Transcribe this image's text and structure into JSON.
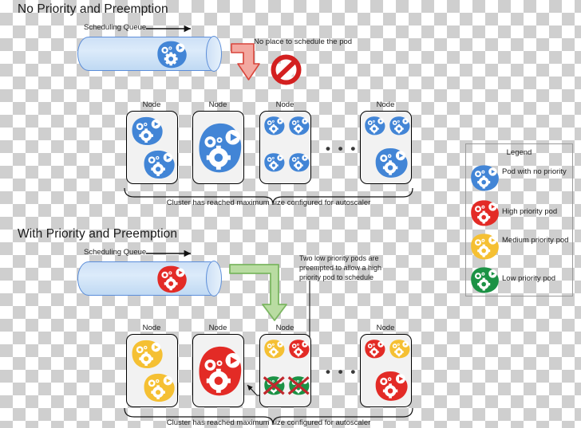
{
  "sections": [
    {
      "id": "no-priority",
      "title": "No Priority and Preemption",
      "queue_label": "Scheduling Queue",
      "annotation": "No place to schedule the pod",
      "cluster_caption": "Cluster has reached maximum size configured for autoscaler",
      "queue_pod_color": "blue",
      "node_label": "Node",
      "ellipsis": "• • •",
      "nodes": [
        {
          "label": "Node",
          "pods": [
            {
              "color": "blue",
              "size": "md"
            },
            {
              "color": "blue",
              "size": "md"
            }
          ]
        },
        {
          "label": "Node",
          "pods": [
            {
              "color": "blue",
              "size": "lg"
            }
          ]
        },
        {
          "label": "Node",
          "pods": [
            {
              "color": "blue",
              "size": "sm"
            },
            {
              "color": "blue",
              "size": "sm"
            },
            {
              "color": "blue",
              "size": "sm"
            },
            {
              "color": "blue",
              "size": "sm"
            }
          ]
        },
        {
          "label": "Node",
          "pods": [
            {
              "color": "blue",
              "size": "sm"
            },
            {
              "color": "blue",
              "size": "sm"
            },
            {
              "color": "blue",
              "size": "md"
            }
          ]
        }
      ]
    },
    {
      "id": "with-priority",
      "title": "With Priority and Preemption",
      "queue_label": "Scheduling Queue",
      "annotation": "Two low priority pods are preempted to allow a high priority pod to schedule",
      "cluster_caption": "Cluster has reached maximum size configured for autoscaler",
      "queue_pod_color": "red",
      "node_label": "Node",
      "ellipsis": "• • •",
      "nodes": [
        {
          "label": "Node",
          "pods": [
            {
              "color": "yellow",
              "size": "md"
            },
            {
              "color": "yellow",
              "size": "md"
            }
          ]
        },
        {
          "label": "Node",
          "pods": [
            {
              "color": "red",
              "size": "lg"
            }
          ]
        },
        {
          "label": "Node",
          "pods": [
            {
              "color": "yellow",
              "size": "sm"
            },
            {
              "color": "red",
              "size": "sm"
            },
            {
              "color": "green",
              "size": "sm",
              "preempted": true
            },
            {
              "color": "green",
              "size": "sm",
              "preempted": true
            }
          ]
        },
        {
          "label": "Node",
          "pods": [
            {
              "color": "red",
              "size": "sm"
            },
            {
              "color": "yellow",
              "size": "sm"
            },
            {
              "color": "red",
              "size": "md"
            }
          ]
        }
      ]
    }
  ],
  "legend": {
    "title": "Legend",
    "items": [
      {
        "color": "blue",
        "label": "Pod with no priority"
      },
      {
        "color": "red",
        "label": "High priority pod"
      },
      {
        "color": "yellow",
        "label": "Medium priority pod"
      },
      {
        "color": "green",
        "label": "Low priority pod"
      }
    ]
  },
  "colors": {
    "blue": "#4285d6",
    "red": "#e32b26",
    "yellow": "#f5c033",
    "green": "#1b9245",
    "arrow_red_fill": "#f3a8a0",
    "arrow_red_stroke": "#d9443a",
    "arrow_green_fill": "#b9dca2",
    "arrow_green_stroke": "#7bb661",
    "prohibition": "#d32020",
    "queue_fill": "#d3e6f8",
    "queue_stroke": "#5b8dd9",
    "node_fill": "#f2f2f2",
    "node_stroke": "#000000",
    "x_mark": "#c0272d"
  }
}
